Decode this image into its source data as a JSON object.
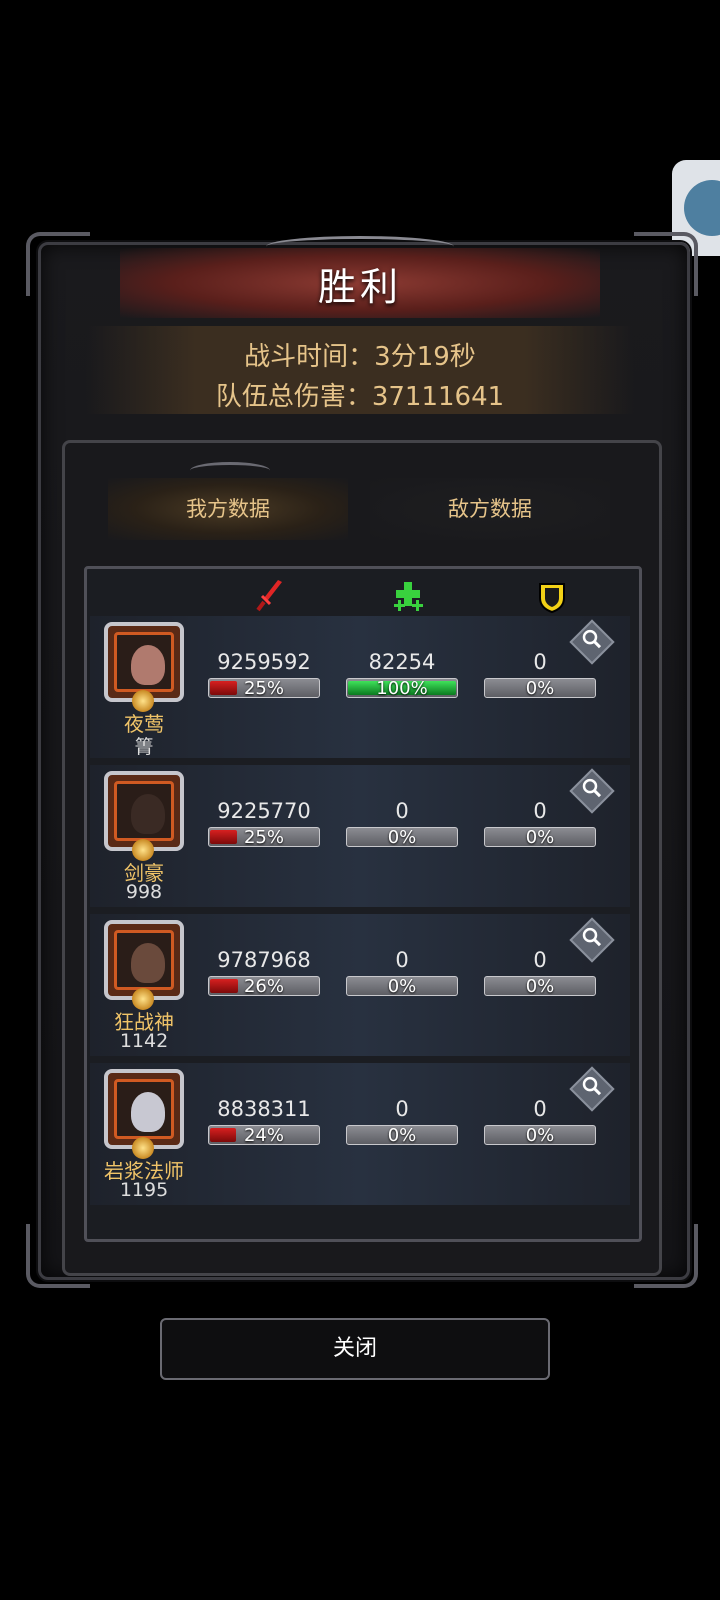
{
  "result_title": "胜利",
  "battle_info": {
    "time_text": "战斗时间：3分19秒",
    "damage_text": "队伍总伤害：37111641"
  },
  "tabs": [
    {
      "label": "我方数据",
      "active": true
    },
    {
      "label": "敌方数据",
      "active": false
    }
  ],
  "stat_icons": [
    "sword-icon",
    "heal-cross-icon",
    "shield-icon"
  ],
  "heroes": [
    {
      "name": "夜莺",
      "power": "箐",
      "damage": "9259592",
      "damage_pct": "25%",
      "damage_ratio": 0.25,
      "heal": "82254",
      "heal_pct": "100%",
      "heal_ratio": 1.0,
      "defense": "0",
      "defense_pct": "0%",
      "defense_ratio": 0
    },
    {
      "name": "剑豪",
      "power": "998",
      "damage": "9225770",
      "damage_pct": "25%",
      "damage_ratio": 0.25,
      "heal": "0",
      "heal_pct": "0%",
      "heal_ratio": 0,
      "defense": "0",
      "defense_pct": "0%",
      "defense_ratio": 0
    },
    {
      "name": "狂战神",
      "power": "1142",
      "damage": "9787968",
      "damage_pct": "26%",
      "damage_ratio": 0.26,
      "heal": "0",
      "heal_pct": "0%",
      "heal_ratio": 0,
      "defense": "0",
      "defense_pct": "0%",
      "defense_ratio": 0
    },
    {
      "name": "岩浆法师",
      "power": "1195",
      "damage": "8838311",
      "damage_pct": "24%",
      "damage_ratio": 0.24,
      "heal": "0",
      "heal_pct": "0%",
      "heal_ratio": 0,
      "defense": "0",
      "defense_pct": "0%",
      "defense_ratio": 0
    }
  ],
  "close_label": "关闭",
  "colors": {
    "gold_text": "#e6c48a",
    "damage_bar": "#d72020",
    "heal_bar": "#3fe25a"
  }
}
